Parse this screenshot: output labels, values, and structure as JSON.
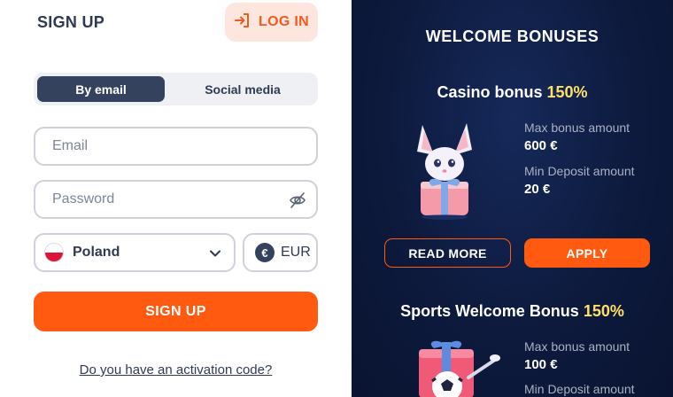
{
  "signup": {
    "title": "SIGN UP",
    "login_label": "LOG IN",
    "tabs": [
      {
        "label": "By email",
        "active": true
      },
      {
        "label": "Social media",
        "active": false
      }
    ],
    "email_placeholder": "Email",
    "password_placeholder": "Password",
    "country": {
      "value": "Poland",
      "flag": "poland-flag"
    },
    "currency": {
      "value": "EUR",
      "symbol": "€"
    },
    "submit_label": "SIGN UP",
    "activation_link": "Do you have an activation code?"
  },
  "bonuses": {
    "title": "WELCOME BONUSES",
    "items": [
      {
        "name": "Casino bonus",
        "percent": "150%",
        "max_label": "Max bonus amount",
        "max_value": "600 €",
        "min_label": "Min Deposit amount",
        "min_value": "20 €",
        "read_more_label": "READ MORE",
        "apply_label": "APPLY"
      },
      {
        "name": "Sports Welcome Bonus",
        "percent": "150%",
        "max_label": "Max bonus amount",
        "max_value": "100 €",
        "min_label": "Min Deposit amount"
      }
    ]
  },
  "colors": {
    "accent": "#ff5a0f",
    "dark_panel": "#0d1a3d",
    "highlight": "#ffe066",
    "tab_active": "#35425e"
  }
}
